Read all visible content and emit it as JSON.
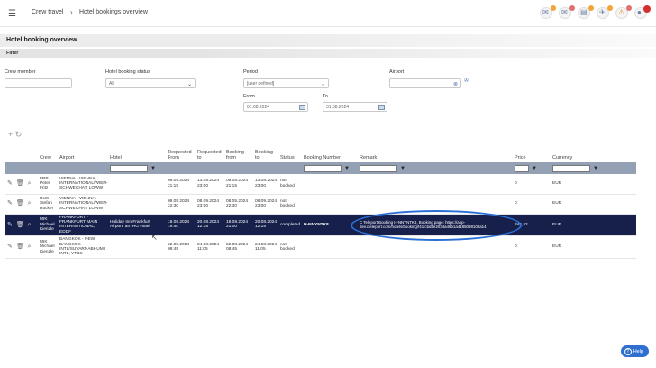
{
  "header": {
    "breadcrumb_1": "Crew travel",
    "breadcrumb_sep": "›",
    "breadcrumb_2": "Hotel bookings overview",
    "icons": [
      "chat-icon",
      "mail-icon",
      "calendar-icon",
      "plane-icon",
      "alert-icon",
      "notification-icon"
    ],
    "colors": {
      "chat": "#f2a33a",
      "mail": "#e07070",
      "calendar": "#f2a33a",
      "plane": "#f2a33a",
      "alert": "#e07070",
      "notification": "#d32f2f"
    }
  },
  "page": {
    "title": "Hotel booking overview",
    "filter_label": "Filter"
  },
  "filters": {
    "crew_member_label": "Crew member",
    "crew_member_value": "",
    "status_label": "Hotel booking status",
    "status_value": "All",
    "period_label": "Period",
    "period_value": "[user defined]",
    "from_label": "From",
    "from_value": "01.08.2024",
    "to_label": "To",
    "to_value": "31.08.2024",
    "airport_label": "Airport",
    "airport_value": ""
  },
  "table": {
    "columns": [
      "Crew",
      "Airport",
      "Hotel",
      "Requested From",
      "Requested to",
      "Booking from",
      "Booking to",
      "Status",
      "Booking Number",
      "Remark",
      "Price",
      "Currency"
    ],
    "rows": [
      {
        "crew": "FRP\nPeter\nFritz",
        "airport": "VIENNA - VIENNA INTERNATIONAL/WIEN-SCHWECHAT, LOWW",
        "hotel": "",
        "req_from": "08.05.2024\n21:15",
        "req_to": "13.08.2024\n23:00",
        "book_from": "08.05.2024\n21:15",
        "book_to": "13.08.2024\n23:00",
        "status": "not booked",
        "booking_number": "",
        "remark": "",
        "price": "0",
        "currency": "EUR"
      },
      {
        "crew": "RUS\nStefan\nRucker",
        "airport": "VIENNA - VIENNA INTERNATIONAL/WIEN-SCHWECHAT, LOWW",
        "hotel": "",
        "req_from": "08.05.2024\n22:30",
        "req_to": "08.09.2024\n23:00",
        "book_from": "08.05.2024\n22:30",
        "book_to": "08.09.2024\n23:00",
        "status": "not booked",
        "booking_number": "",
        "remark": "",
        "price": "0",
        "currency": "EUR"
      },
      {
        "crew": "MIK\nMichael\nKienzle",
        "airport": "FRANKFURT - FRANKFURT MAIN INTERNATIONAL, EDDF",
        "hotel": "Holiday Inn Frankfurt Airport, an IHG Hotel",
        "req_from": "18.08.2024\n19:40",
        "req_to": "20.08.2024\n12:15",
        "book_from": "18.08.2024\n21:00",
        "book_to": "20.08.2024\n12:15",
        "status": "completed",
        "booking_number": "H-NNYNTK8",
        "remark": "C Teleport Booking H-NNYNTK8, Booking page: https://app-dev.cteleport.com/hotels/booking/f41fcbd5e2034a46b1a4185098108a14",
        "price": "346,42",
        "currency": "EUR"
      },
      {
        "crew": "MIK\nMichael\nKienzle",
        "airport": "BANGKOK - NEW BANGKOK INTL/SUVARNABHUMI INTL, VTBS",
        "hotel": "",
        "req_from": "22.08.2024\n08:45",
        "req_to": "24.08.2024\n11:05",
        "book_from": "22.08.2024\n08:45",
        "book_to": "24.08.2024\n11:05",
        "status": "not booked",
        "booking_number": "",
        "remark": "",
        "price": "0",
        "currency": "EUR"
      }
    ]
  },
  "help": {
    "label": "Help"
  }
}
